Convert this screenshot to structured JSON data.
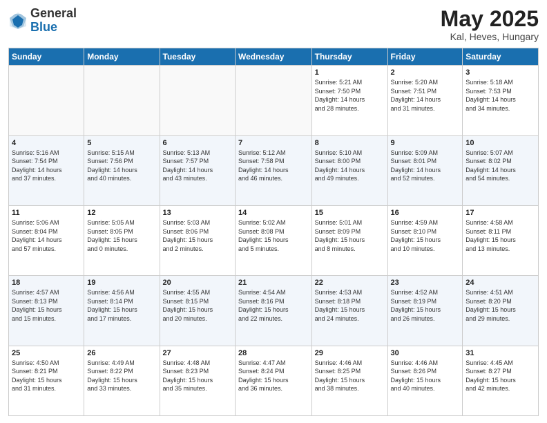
{
  "header": {
    "logo_general": "General",
    "logo_blue": "Blue",
    "title": "May 2025",
    "location": "Kal, Heves, Hungary"
  },
  "days_of_week": [
    "Sunday",
    "Monday",
    "Tuesday",
    "Wednesday",
    "Thursday",
    "Friday",
    "Saturday"
  ],
  "weeks": [
    [
      {
        "num": "",
        "info": ""
      },
      {
        "num": "",
        "info": ""
      },
      {
        "num": "",
        "info": ""
      },
      {
        "num": "",
        "info": ""
      },
      {
        "num": "1",
        "info": "Sunrise: 5:21 AM\nSunset: 7:50 PM\nDaylight: 14 hours\nand 28 minutes."
      },
      {
        "num": "2",
        "info": "Sunrise: 5:20 AM\nSunset: 7:51 PM\nDaylight: 14 hours\nand 31 minutes."
      },
      {
        "num": "3",
        "info": "Sunrise: 5:18 AM\nSunset: 7:53 PM\nDaylight: 14 hours\nand 34 minutes."
      }
    ],
    [
      {
        "num": "4",
        "info": "Sunrise: 5:16 AM\nSunset: 7:54 PM\nDaylight: 14 hours\nand 37 minutes."
      },
      {
        "num": "5",
        "info": "Sunrise: 5:15 AM\nSunset: 7:56 PM\nDaylight: 14 hours\nand 40 minutes."
      },
      {
        "num": "6",
        "info": "Sunrise: 5:13 AM\nSunset: 7:57 PM\nDaylight: 14 hours\nand 43 minutes."
      },
      {
        "num": "7",
        "info": "Sunrise: 5:12 AM\nSunset: 7:58 PM\nDaylight: 14 hours\nand 46 minutes."
      },
      {
        "num": "8",
        "info": "Sunrise: 5:10 AM\nSunset: 8:00 PM\nDaylight: 14 hours\nand 49 minutes."
      },
      {
        "num": "9",
        "info": "Sunrise: 5:09 AM\nSunset: 8:01 PM\nDaylight: 14 hours\nand 52 minutes."
      },
      {
        "num": "10",
        "info": "Sunrise: 5:07 AM\nSunset: 8:02 PM\nDaylight: 14 hours\nand 54 minutes."
      }
    ],
    [
      {
        "num": "11",
        "info": "Sunrise: 5:06 AM\nSunset: 8:04 PM\nDaylight: 14 hours\nand 57 minutes."
      },
      {
        "num": "12",
        "info": "Sunrise: 5:05 AM\nSunset: 8:05 PM\nDaylight: 15 hours\nand 0 minutes."
      },
      {
        "num": "13",
        "info": "Sunrise: 5:03 AM\nSunset: 8:06 PM\nDaylight: 15 hours\nand 2 minutes."
      },
      {
        "num": "14",
        "info": "Sunrise: 5:02 AM\nSunset: 8:08 PM\nDaylight: 15 hours\nand 5 minutes."
      },
      {
        "num": "15",
        "info": "Sunrise: 5:01 AM\nSunset: 8:09 PM\nDaylight: 15 hours\nand 8 minutes."
      },
      {
        "num": "16",
        "info": "Sunrise: 4:59 AM\nSunset: 8:10 PM\nDaylight: 15 hours\nand 10 minutes."
      },
      {
        "num": "17",
        "info": "Sunrise: 4:58 AM\nSunset: 8:11 PM\nDaylight: 15 hours\nand 13 minutes."
      }
    ],
    [
      {
        "num": "18",
        "info": "Sunrise: 4:57 AM\nSunset: 8:13 PM\nDaylight: 15 hours\nand 15 minutes."
      },
      {
        "num": "19",
        "info": "Sunrise: 4:56 AM\nSunset: 8:14 PM\nDaylight: 15 hours\nand 17 minutes."
      },
      {
        "num": "20",
        "info": "Sunrise: 4:55 AM\nSunset: 8:15 PM\nDaylight: 15 hours\nand 20 minutes."
      },
      {
        "num": "21",
        "info": "Sunrise: 4:54 AM\nSunset: 8:16 PM\nDaylight: 15 hours\nand 22 minutes."
      },
      {
        "num": "22",
        "info": "Sunrise: 4:53 AM\nSunset: 8:18 PM\nDaylight: 15 hours\nand 24 minutes."
      },
      {
        "num": "23",
        "info": "Sunrise: 4:52 AM\nSunset: 8:19 PM\nDaylight: 15 hours\nand 26 minutes."
      },
      {
        "num": "24",
        "info": "Sunrise: 4:51 AM\nSunset: 8:20 PM\nDaylight: 15 hours\nand 29 minutes."
      }
    ],
    [
      {
        "num": "25",
        "info": "Sunrise: 4:50 AM\nSunset: 8:21 PM\nDaylight: 15 hours\nand 31 minutes."
      },
      {
        "num": "26",
        "info": "Sunrise: 4:49 AM\nSunset: 8:22 PM\nDaylight: 15 hours\nand 33 minutes."
      },
      {
        "num": "27",
        "info": "Sunrise: 4:48 AM\nSunset: 8:23 PM\nDaylight: 15 hours\nand 35 minutes."
      },
      {
        "num": "28",
        "info": "Sunrise: 4:47 AM\nSunset: 8:24 PM\nDaylight: 15 hours\nand 36 minutes."
      },
      {
        "num": "29",
        "info": "Sunrise: 4:46 AM\nSunset: 8:25 PM\nDaylight: 15 hours\nand 38 minutes."
      },
      {
        "num": "30",
        "info": "Sunrise: 4:46 AM\nSunset: 8:26 PM\nDaylight: 15 hours\nand 40 minutes."
      },
      {
        "num": "31",
        "info": "Sunrise: 4:45 AM\nSunset: 8:27 PM\nDaylight: 15 hours\nand 42 minutes."
      }
    ]
  ]
}
